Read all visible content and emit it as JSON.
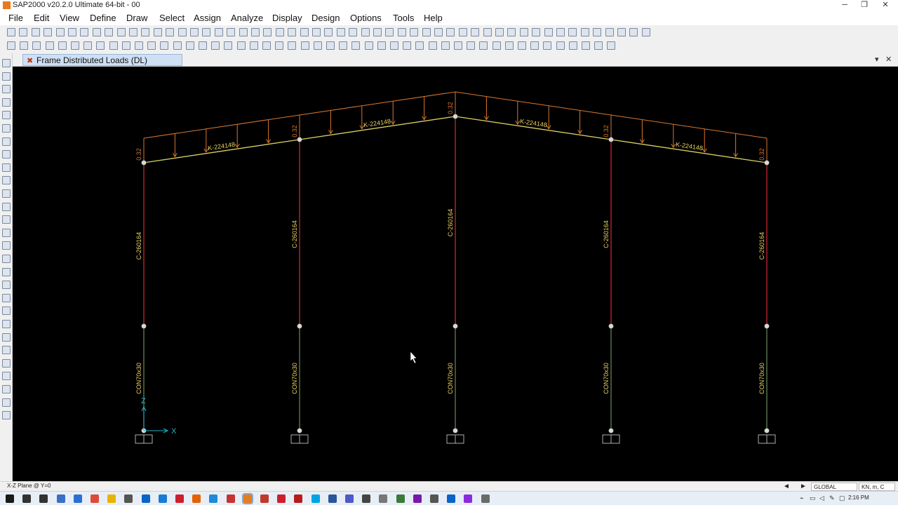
{
  "window": {
    "title": "SAP2000 v20.2.0 Ultimate 64-bit - 00",
    "minimize": "─",
    "restore": "❐",
    "close": "✕"
  },
  "menu": [
    "File",
    "Edit",
    "View",
    "Define",
    "Draw",
    "Select",
    "Assign",
    "Analyze",
    "Display",
    "Design",
    "Options",
    "Tools",
    "Help"
  ],
  "toolbar_row1": [
    "new-model-icon",
    "open-icon",
    "save-icon",
    "print-icon",
    "undo-icon",
    "redo-icon",
    "pencil-icon",
    "lock-icon",
    "run-analysis-icon",
    "run-stop-icon",
    "zoom-rubber-band-icon",
    "zoom-all-icon",
    "zoom-in-icon",
    "zoom-out-icon",
    "zoom-previous-icon",
    "pan-icon",
    "rotate-icon",
    "view-3d-icon",
    "view-xy-icon",
    "view-xz-icon",
    "view-yz-icon",
    "view-nv-icon",
    "rotate-left-icon",
    "perspective-icon",
    "move-up-icon",
    "move-down-icon",
    "show-all-icon",
    "check-icon",
    "object-shrink-icon",
    "set-display-icon",
    "display-all-icon",
    "options-icon",
    "frame-icon",
    "cable-icon",
    "tendon-icon",
    "area-icon",
    "solid-icon",
    "link-icon",
    "section-cut-icon",
    "text-icon",
    "table-icon",
    "spring-icon",
    "support-icon",
    "cut-icon",
    "copy-icon",
    "paste-icon",
    "delete-icon",
    "replicate-icon",
    "merge-icon",
    "snap-icon",
    "divide-icon",
    "join-icon",
    "reshape-icon"
  ],
  "toolbar_row2": [
    "select-icon",
    "pointer-icon",
    "joint-icon",
    "frame-draw-icon",
    "grid-icon",
    "quick-frame-icon",
    "brace-icon",
    "secondary-beam-icon",
    "area-draw-icon",
    "rect-area-icon",
    "quick-area-icon",
    "solid-draw-icon",
    "text-draw-icon",
    "dimension-icon",
    "section-cut-draw-icon",
    "reference-line-icon",
    "reference-point-icon",
    "link-draw-icon",
    "tendon-draw-icon",
    "cable-draw-icon",
    "spring-draw-icon",
    "restraint-icon",
    "constraint-icon",
    "mass-icon",
    "load-pattern-icon",
    "load-case-icon",
    "combo-icon",
    "analysis-options-icon",
    "frame-release-icon",
    "frame-hinge-icon",
    "frame-insertion-icon",
    "area-thickness-icon",
    "area-edge-icon",
    "area-stiffness-icon",
    "joint-pattern-icon",
    "joint-load-icon",
    "frame-load-icon",
    "area-load-icon",
    "deformed-shape-icon",
    "force-diagram-icon",
    "stress-icon",
    "virtual-work-icon",
    "influence-icon",
    "story-drift-icon",
    "table-display-icon",
    "steel-design-icon",
    "concrete-design-icon",
    "aluminum-design-icon"
  ],
  "left_toolbar": [
    "select-pointer-icon",
    "reshape-icon",
    "joint-draw-icon",
    "frame-draw-icon",
    "quick-frame-icon",
    "brace-draw-icon",
    "secondary-beam-icon",
    "area-draw-icon",
    "rect-area-icon",
    "quick-area-icon",
    "solid-draw-icon",
    "link-draw-icon",
    "tendon-draw-icon",
    "cable-draw-icon",
    "spring-draw-icon",
    "section-cut-icon",
    "dimension-icon",
    "reference-point-icon",
    "snap-joint-icon",
    "snap-line-icon",
    "snap-intersection-icon",
    "snap-perpendicular-icon",
    "snap-grid-icon",
    "snap-all-icon",
    "select-all-icon",
    "previous-select-icon",
    "clear-select-icon",
    "get-previous-icon"
  ],
  "tab": {
    "label": "Frame Distributed Loads (DL)",
    "icon": "x-frame-icon",
    "menu": "▾",
    "close": "✕"
  },
  "canvas": {
    "background": "#000000",
    "colors": {
      "load_line": "#d9772e",
      "beam": "#d8d060",
      "column": "#b8242e",
      "pedestal": "#6a8a5a",
      "joint": "#d8d8d8",
      "label": "#e8d060",
      "axis": "#1fb5c8"
    },
    "load_values": [
      "0.32",
      "0.32",
      "0.32",
      "0.32",
      "0.32"
    ],
    "beam_sections": [
      "K-224148",
      "K-224148",
      "K-224148",
      "K-224148"
    ],
    "column_sections": [
      "C-260164",
      "C-260164",
      "C-260164",
      "C-260164",
      "C-260164"
    ],
    "pedestal_sections": [
      "CON70x30",
      "CON70x30",
      "CON70x30",
      "CON70x30",
      "CON70x30"
    ],
    "axis": {
      "z_label": "Z",
      "x_label": "X"
    }
  },
  "statusbar": {
    "left_text": "X-Z Plane @ Y=0",
    "coord_system": "GLOBAL",
    "units": "KN, m, C"
  },
  "taskbar": {
    "icons": [
      "start-icon",
      "search-icon",
      "task-view-icon",
      "mail-icon",
      "cortana-icon",
      "chrome-icon",
      "file-explorer-icon",
      "store-icon",
      "outlook-icon",
      "edge-icon",
      "opera-icon",
      "firefox-icon",
      "ie-icon",
      "vivaldi-icon",
      "sap2000-icon",
      "pdf-icon",
      "autocad-icon",
      "acrobat-icon",
      "skype-icon",
      "word-icon",
      "teams-icon",
      "etabs-icon",
      "safe-icon",
      "notepad-icon",
      "onenote-icon",
      "settings-icon",
      "photos-icon",
      "snipping-icon",
      "active-app-icon"
    ],
    "clock": "2:16 PM",
    "tray": [
      "network-icon",
      "battery-icon",
      "volume-icon",
      "ime-icon",
      "notification-icon"
    ]
  }
}
